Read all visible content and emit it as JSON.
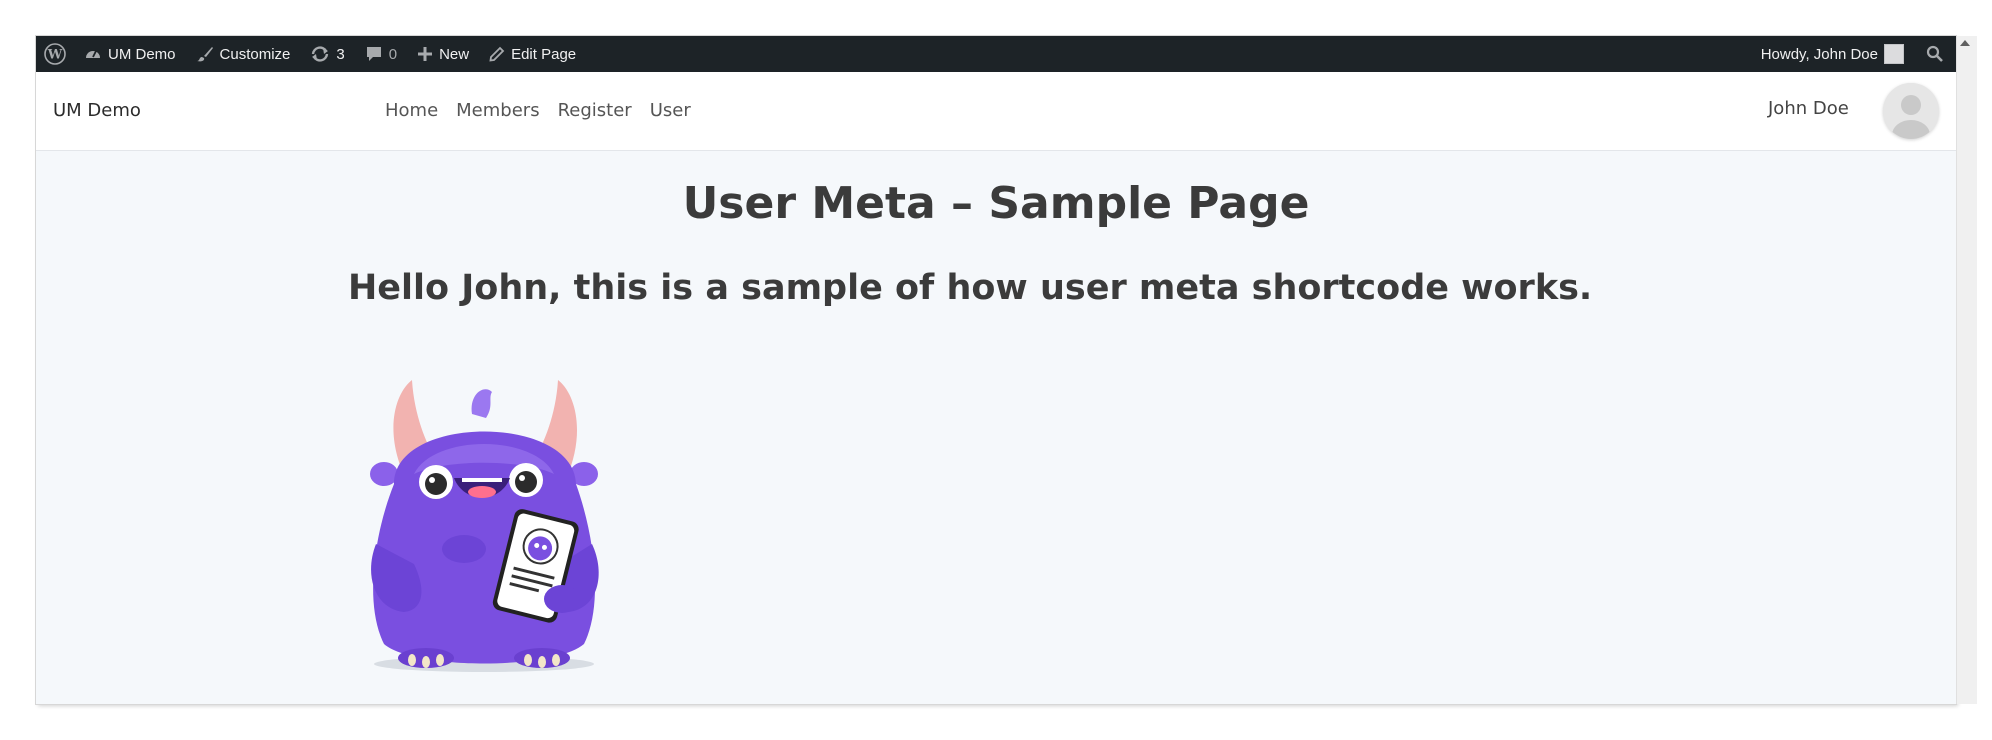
{
  "adminbar": {
    "site_name": "UM Demo",
    "customize": "Customize",
    "updates_count": "3",
    "comments_count": "0",
    "new_label": "New",
    "edit_page": "Edit Page",
    "howdy": "Howdy, John Doe"
  },
  "header": {
    "site_title": "UM Demo",
    "nav": [
      "Home",
      "Members",
      "Register",
      "User"
    ],
    "user_name": "John Doe"
  },
  "content": {
    "page_title": "User Meta – Sample Page",
    "subheading": "Hello John, this is a sample of how user meta shortcode works."
  },
  "colors": {
    "adminbar_bg": "#1d2327",
    "content_bg": "#f5f8fb",
    "monster_purple": "#7a4fe0"
  }
}
